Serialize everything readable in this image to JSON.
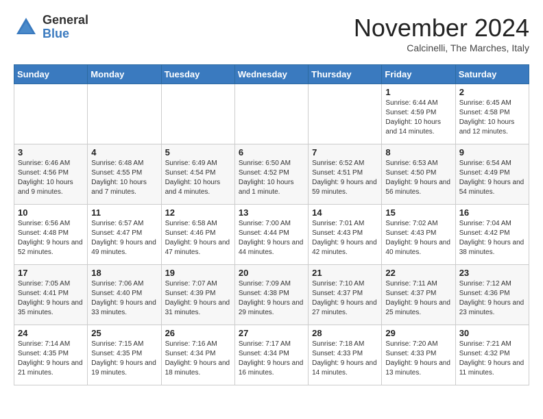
{
  "logo": {
    "general": "General",
    "blue": "Blue"
  },
  "title": "November 2024",
  "subtitle": "Calcinelli, The Marches, Italy",
  "headers": [
    "Sunday",
    "Monday",
    "Tuesday",
    "Wednesday",
    "Thursday",
    "Friday",
    "Saturday"
  ],
  "weeks": [
    [
      {
        "day": "",
        "info": ""
      },
      {
        "day": "",
        "info": ""
      },
      {
        "day": "",
        "info": ""
      },
      {
        "day": "",
        "info": ""
      },
      {
        "day": "",
        "info": ""
      },
      {
        "day": "1",
        "info": "Sunrise: 6:44 AM\nSunset: 4:59 PM\nDaylight: 10 hours and 14 minutes."
      },
      {
        "day": "2",
        "info": "Sunrise: 6:45 AM\nSunset: 4:58 PM\nDaylight: 10 hours and 12 minutes."
      }
    ],
    [
      {
        "day": "3",
        "info": "Sunrise: 6:46 AM\nSunset: 4:56 PM\nDaylight: 10 hours and 9 minutes."
      },
      {
        "day": "4",
        "info": "Sunrise: 6:48 AM\nSunset: 4:55 PM\nDaylight: 10 hours and 7 minutes."
      },
      {
        "day": "5",
        "info": "Sunrise: 6:49 AM\nSunset: 4:54 PM\nDaylight: 10 hours and 4 minutes."
      },
      {
        "day": "6",
        "info": "Sunrise: 6:50 AM\nSunset: 4:52 PM\nDaylight: 10 hours and 1 minute."
      },
      {
        "day": "7",
        "info": "Sunrise: 6:52 AM\nSunset: 4:51 PM\nDaylight: 9 hours and 59 minutes."
      },
      {
        "day": "8",
        "info": "Sunrise: 6:53 AM\nSunset: 4:50 PM\nDaylight: 9 hours and 56 minutes."
      },
      {
        "day": "9",
        "info": "Sunrise: 6:54 AM\nSunset: 4:49 PM\nDaylight: 9 hours and 54 minutes."
      }
    ],
    [
      {
        "day": "10",
        "info": "Sunrise: 6:56 AM\nSunset: 4:48 PM\nDaylight: 9 hours and 52 minutes."
      },
      {
        "day": "11",
        "info": "Sunrise: 6:57 AM\nSunset: 4:47 PM\nDaylight: 9 hours and 49 minutes."
      },
      {
        "day": "12",
        "info": "Sunrise: 6:58 AM\nSunset: 4:46 PM\nDaylight: 9 hours and 47 minutes."
      },
      {
        "day": "13",
        "info": "Sunrise: 7:00 AM\nSunset: 4:44 PM\nDaylight: 9 hours and 44 minutes."
      },
      {
        "day": "14",
        "info": "Sunrise: 7:01 AM\nSunset: 4:43 PM\nDaylight: 9 hours and 42 minutes."
      },
      {
        "day": "15",
        "info": "Sunrise: 7:02 AM\nSunset: 4:43 PM\nDaylight: 9 hours and 40 minutes."
      },
      {
        "day": "16",
        "info": "Sunrise: 7:04 AM\nSunset: 4:42 PM\nDaylight: 9 hours and 38 minutes."
      }
    ],
    [
      {
        "day": "17",
        "info": "Sunrise: 7:05 AM\nSunset: 4:41 PM\nDaylight: 9 hours and 35 minutes."
      },
      {
        "day": "18",
        "info": "Sunrise: 7:06 AM\nSunset: 4:40 PM\nDaylight: 9 hours and 33 minutes."
      },
      {
        "day": "19",
        "info": "Sunrise: 7:07 AM\nSunset: 4:39 PM\nDaylight: 9 hours and 31 minutes."
      },
      {
        "day": "20",
        "info": "Sunrise: 7:09 AM\nSunset: 4:38 PM\nDaylight: 9 hours and 29 minutes."
      },
      {
        "day": "21",
        "info": "Sunrise: 7:10 AM\nSunset: 4:37 PM\nDaylight: 9 hours and 27 minutes."
      },
      {
        "day": "22",
        "info": "Sunrise: 7:11 AM\nSunset: 4:37 PM\nDaylight: 9 hours and 25 minutes."
      },
      {
        "day": "23",
        "info": "Sunrise: 7:12 AM\nSunset: 4:36 PM\nDaylight: 9 hours and 23 minutes."
      }
    ],
    [
      {
        "day": "24",
        "info": "Sunrise: 7:14 AM\nSunset: 4:35 PM\nDaylight: 9 hours and 21 minutes."
      },
      {
        "day": "25",
        "info": "Sunrise: 7:15 AM\nSunset: 4:35 PM\nDaylight: 9 hours and 19 minutes."
      },
      {
        "day": "26",
        "info": "Sunrise: 7:16 AM\nSunset: 4:34 PM\nDaylight: 9 hours and 18 minutes."
      },
      {
        "day": "27",
        "info": "Sunrise: 7:17 AM\nSunset: 4:34 PM\nDaylight: 9 hours and 16 minutes."
      },
      {
        "day": "28",
        "info": "Sunrise: 7:18 AM\nSunset: 4:33 PM\nDaylight: 9 hours and 14 minutes."
      },
      {
        "day": "29",
        "info": "Sunrise: 7:20 AM\nSunset: 4:33 PM\nDaylight: 9 hours and 13 minutes."
      },
      {
        "day": "30",
        "info": "Sunrise: 7:21 AM\nSunset: 4:32 PM\nDaylight: 9 hours and 11 minutes."
      }
    ]
  ]
}
